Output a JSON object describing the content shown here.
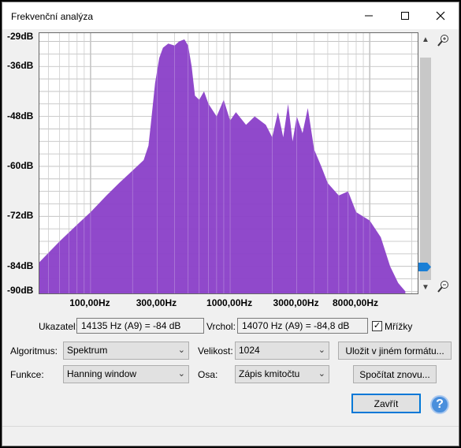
{
  "window": {
    "title": "Frekvenční analýza",
    "minimize_icon": "minimize-icon",
    "maximize_icon": "maximize-icon",
    "close_icon": "close-icon"
  },
  "chart_data": {
    "type": "area",
    "x_scale": "log",
    "y_unit": "dB",
    "y_ticks": [
      "-29dB",
      "-36dB",
      "-48dB",
      "-60dB",
      "-72dB",
      "-84dB",
      "-90dB"
    ],
    "x_ticks": [
      "100,00Hz",
      "300,00Hz",
      "1000,00Hz",
      "3000,00Hz",
      "8000,00Hz"
    ],
    "ylim": [
      -90.5,
      -28
    ],
    "xlim": [
      43,
      22050
    ],
    "grid": true,
    "fill_color": "#8a3fc8",
    "series": [
      {
        "points": [
          [
            43,
            -83
          ],
          [
            60,
            -78
          ],
          [
            80,
            -74
          ],
          [
            100,
            -71
          ],
          [
            130,
            -67
          ],
          [
            160,
            -64
          ],
          [
            200,
            -61
          ],
          [
            240,
            -58.5
          ],
          [
            260,
            -55
          ],
          [
            270,
            -50
          ],
          [
            290,
            -40
          ],
          [
            310,
            -34
          ],
          [
            330,
            -31.5
          ],
          [
            360,
            -30.5
          ],
          [
            400,
            -31
          ],
          [
            430,
            -30
          ],
          [
            470,
            -29.5
          ],
          [
            500,
            -31
          ],
          [
            530,
            -36
          ],
          [
            560,
            -43
          ],
          [
            600,
            -44
          ],
          [
            650,
            -42
          ],
          [
            700,
            -45
          ],
          [
            800,
            -48
          ],
          [
            900,
            -44
          ],
          [
            1000,
            -49
          ],
          [
            1100,
            -47
          ],
          [
            1300,
            -50
          ],
          [
            1500,
            -48
          ],
          [
            1800,
            -50
          ],
          [
            2000,
            -53
          ],
          [
            2200,
            -47
          ],
          [
            2400,
            -53
          ],
          [
            2600,
            -45
          ],
          [
            2800,
            -54
          ],
          [
            3000,
            -48
          ],
          [
            3300,
            -52
          ],
          [
            3600,
            -46
          ],
          [
            4000,
            -56
          ],
          [
            4500,
            -60
          ],
          [
            5000,
            -64
          ],
          [
            6000,
            -67
          ],
          [
            7000,
            -66
          ],
          [
            8000,
            -71
          ],
          [
            10000,
            -73
          ],
          [
            12000,
            -77
          ],
          [
            14000,
            -84
          ],
          [
            16000,
            -88
          ],
          [
            18000,
            -90
          ]
        ]
      }
    ]
  },
  "pointer": {
    "label": "Ukazatel:",
    "value": "14135 Hz (A9) = -84 dB"
  },
  "peak": {
    "label": "Vrchol:",
    "value": "14070 Hz (A9) = -84,8 dB"
  },
  "grid_checkbox": {
    "label": "Mřížky",
    "checked": "✓"
  },
  "algorithm": {
    "label": "Algoritmus:",
    "value": "Spektrum"
  },
  "size": {
    "label": "Velikost:",
    "value": "1024"
  },
  "function": {
    "label": "Funkce:",
    "value": "Hanning window"
  },
  "axis": {
    "label": "Osa:",
    "value": "Zápis kmitočtu"
  },
  "buttons": {
    "export": "Uložit v jiném formátu...",
    "replot": "Spočítat znovu...",
    "close": "Zavřít",
    "help": "?"
  },
  "zoom": {
    "in": "🔍+",
    "out": "🔍-"
  }
}
